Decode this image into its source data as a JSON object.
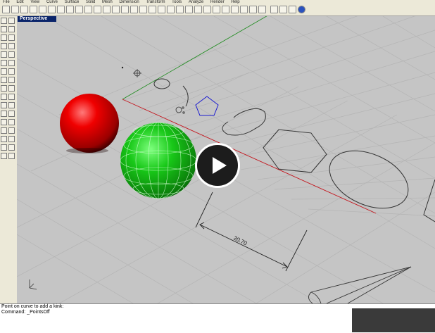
{
  "menu": {
    "items": [
      "File",
      "Edit",
      "View",
      "Curve",
      "Surface",
      "Solid",
      "Mesh",
      "Dimension",
      "Transform",
      "Tools",
      "Analyze",
      "Render",
      "Help"
    ]
  },
  "viewport": {
    "title": "Perspective",
    "dimension_text": "20.70"
  },
  "command": {
    "prompt": "Point on curve to add a kink:",
    "last": "Command: _PointsOff"
  },
  "colors": {
    "title_bar": "#0a246a",
    "grid": "#b3b3b3",
    "grid_bg": "#c5c5c5",
    "x_axis": "#c4141c",
    "y_axis": "#1a8a1a",
    "red_sphere": "#e60000",
    "green_sphere": "#16c516",
    "pentagon": "#1a1ad0"
  },
  "video": {
    "control": "play-icon"
  }
}
